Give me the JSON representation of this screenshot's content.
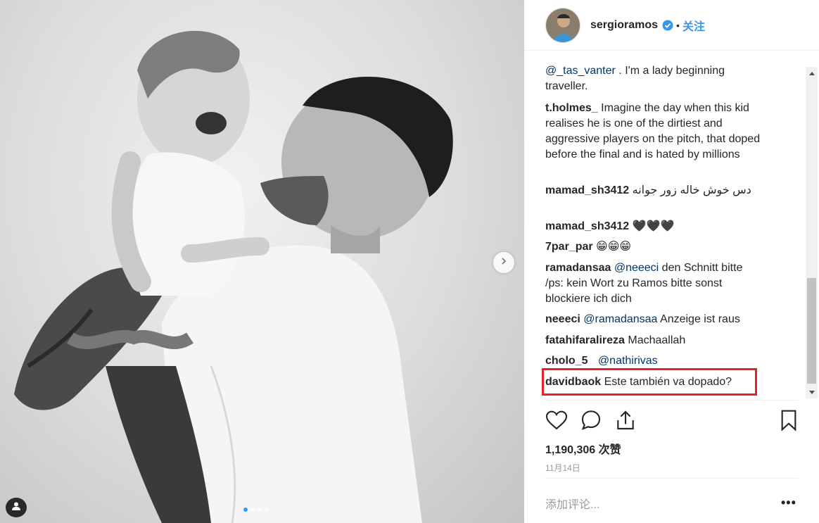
{
  "post": {
    "username": "sergioramos",
    "follow_label": "关注",
    "separator": "•",
    "likes_count": "1,190,306 次赞",
    "date": "11月14日",
    "add_comment_placeholder": "添加评论...",
    "more_label": "•••",
    "carousel_total": 4,
    "carousel_active": 1
  },
  "comments": [
    {
      "mention": "@_tas_vanter",
      "text": " . I'm a lady beginning traveller."
    },
    {
      "username": "t.holmes_",
      "text": " Imagine the day when this kid realises he is one of the dirtiest and aggressive players on the pitch, that doped before the final and is hated by millions"
    },
    {
      "username": "mamad_sh3412",
      "text": "دس خوش خاله زور جوانه"
    },
    {
      "username": "mamad_sh3412",
      "text": " 🖤🖤🖤"
    },
    {
      "username": "7par_par",
      "text": " 😁😁😁"
    },
    {
      "username": "ramadansaa",
      "mention": "@neeeci",
      "text": " den Schnitt bitte /ps: kein Wort zu Ramos bitte sonst blockiere ich dich"
    },
    {
      "username": "neeeci",
      "mention": "@ramadansaa",
      "text": " Anzeige ist raus"
    },
    {
      "username": "fatahifaralireza",
      "text": " Machaallah"
    },
    {
      "username": "cholo_5",
      "mention": "@nathirivas",
      "text": ""
    },
    {
      "username": "davidbaok",
      "text": " Este también va dopado?"
    }
  ],
  "colors": {
    "accent": "#3897f0",
    "mention": "#003569",
    "highlight_box": "#e8222b",
    "muted": "#999999"
  },
  "icons": [
    "verified-badge-icon",
    "heart-icon",
    "comment-icon",
    "share-icon",
    "bookmark-icon",
    "chevron-right-icon",
    "user-tag-icon"
  ]
}
